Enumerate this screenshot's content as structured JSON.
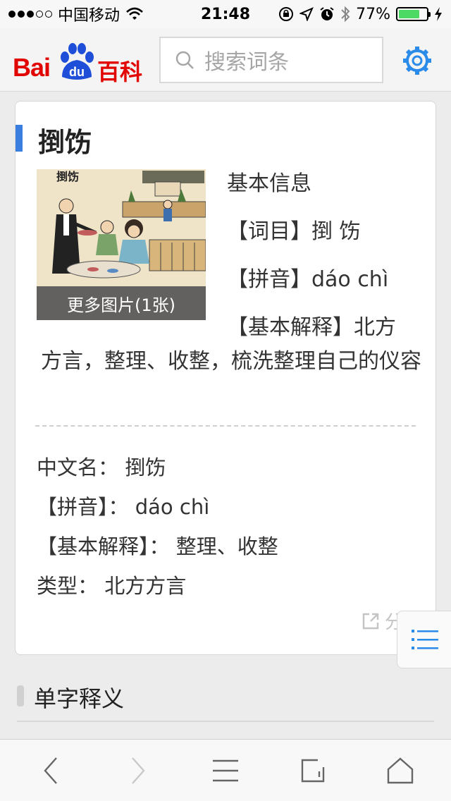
{
  "status_bar": {
    "carrier": "中国移动",
    "time": "21:48",
    "battery": "77%",
    "battery_level": 0.77,
    "signal_bars_filled": 3,
    "signal_bars_total": 5,
    "icons": [
      "wifi-icon",
      "orientation-lock-icon",
      "location-icon",
      "alarm-icon",
      "bluetooth-icon",
      "charging-icon"
    ]
  },
  "header": {
    "logo_text_left": "Bai",
    "logo_text_paw": "du",
    "logo_text_right": "百科",
    "search_placeholder": "搜索词条",
    "search_icon": "search-icon",
    "settings_icon": "gear-icon",
    "accent_color": "#2a8be8"
  },
  "entry": {
    "title": "捯饬",
    "image_caption": "更多图片(1张)",
    "image_label": "捯饬",
    "basic_info_heading": "基本信息",
    "lines": [
      "【词目】捯 饬",
      "【拼音】dáo chì",
      "【基本解释】北方"
    ],
    "description_continued": "方言，整理、收整，梳洗整理自己的仪容",
    "properties": [
      {
        "label": "中文名",
        "value": "捯饬"
      },
      {
        "label": "【拼音】",
        "value": "dáo chì"
      },
      {
        "label": "【基本解释】",
        "value": "整理、收整"
      },
      {
        "label": "类型",
        "value": "北方方言"
      }
    ],
    "share_label": "分享"
  },
  "sections": {
    "single_char_title": "单字释义"
  },
  "toolbar": {
    "items": [
      "back-icon",
      "forward-icon",
      "menu-icon",
      "tabs-icon",
      "home-icon"
    ]
  },
  "colors": {
    "title_bar": "#3a7ee0",
    "logo_red": "#e10601",
    "logo_blue": "#1f4fd8",
    "battery_green": "#4cd964"
  }
}
